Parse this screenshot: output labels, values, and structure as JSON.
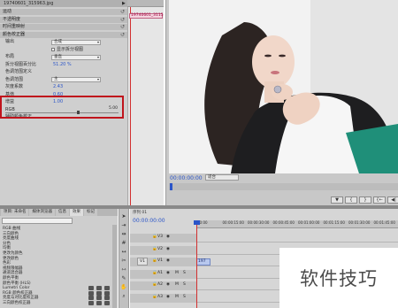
{
  "effect_controls": {
    "source_title": "19740601_315963.jpg",
    "clip_name": "19740601_3115",
    "rows": [
      {
        "label": "运动",
        "type": "header"
      },
      {
        "label": "不透明度",
        "type": "header"
      },
      {
        "label": "时间重映射",
        "type": "header"
      },
      {
        "label": "颜色校正器",
        "type": "header"
      },
      {
        "label": "输出",
        "type": "dropdown",
        "value": "合成"
      },
      {
        "label": "显示拆分视图",
        "type": "checkbox"
      },
      {
        "label": "布局",
        "type": "dropdown",
        "value": "垂直"
      },
      {
        "label": "拆分视图百分比",
        "value": "51.20 %"
      },
      {
        "label": "色调范围定义",
        "type": "plain"
      },
      {
        "label": "色调范围",
        "type": "dropdown",
        "value": "主"
      },
      {
        "label": "灰度系数",
        "value": "2.43"
      },
      {
        "label": "基值",
        "value": "0.60"
      },
      {
        "label": "增益",
        "value": "1.00"
      },
      {
        "label": "RGB",
        "type": "plain"
      },
      {
        "label": "辅助颜色校正",
        "type": "plain"
      }
    ],
    "slider_max": "5.00",
    "slider_fraction": 0.63
  },
  "program_monitor": {
    "timecode": "00:00:00:00",
    "fit_dropdown": "适合",
    "transport": [
      "▼",
      "{",
      "}",
      "{←",
      "◀|"
    ],
    "page": "2"
  },
  "effects_panel": {
    "tabs": [
      "项目: 未命名",
      "媒体浏览器",
      "信息",
      "效果",
      "标记"
    ],
    "active_tab": 3,
    "items": [
      {
        "label": "RGB 曲线"
      },
      {
        "label": "三向颜色"
      },
      {
        "label": "亮度曲线"
      },
      {
        "label": "分色"
      },
      {
        "label": "均衡"
      },
      {
        "label": "更改为颜色"
      },
      {
        "label": "更改颜色"
      },
      {
        "label": "色彩"
      },
      {
        "label": "视频限幅器"
      },
      {
        "label": "通道混合器"
      },
      {
        "label": "颜色平衡"
      },
      {
        "label": "颜色平衡 (HLS)"
      },
      {
        "label": "Lumetri Color",
        "badges": 3
      },
      {
        "label": "RGB 颜色校正器",
        "badges": 3
      },
      {
        "label": "亮度与对比度校正器",
        "badges": 3
      },
      {
        "label": "三向颜色校正器",
        "badges": 3
      }
    ]
  },
  "sequence": {
    "tab_label": "序列 01",
    "timecode": "00:00:00:00",
    "ruler_labels": [
      "00:00",
      "00:00:15:00",
      "00:00:30:00",
      "00:00:45:00",
      "00:01:00:00",
      "00:01:15:00",
      "00:01:30:00",
      "00:01:45:00"
    ],
    "tracks": [
      {
        "name": "V3",
        "m": "",
        "s": ""
      },
      {
        "name": "V2",
        "m": "",
        "s": ""
      },
      {
        "name": "V1",
        "m": "",
        "s": "",
        "source": "V1",
        "clip": "197"
      },
      {
        "name": "A1",
        "m": "M",
        "s": "S"
      },
      {
        "name": "A2",
        "m": "M",
        "s": "S"
      },
      {
        "name": "A3",
        "m": "M",
        "s": "S"
      }
    ]
  },
  "watermark": {
    "text": "软件技巧"
  }
}
